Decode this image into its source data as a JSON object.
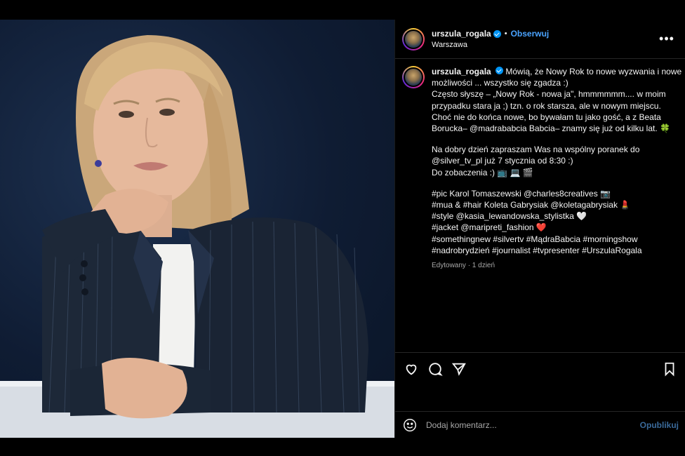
{
  "post": {
    "username": "urszula_rogala",
    "verified": true,
    "follow_label": "Obserwuj",
    "location": "Warszawa",
    "more_icon": "more-horizontal-icon"
  },
  "caption": {
    "lines": [
      "Mówią, że Nowy Rok to nowe wyzwania i nowe",
      "możliwości ... wszystko się zgadza :)",
      "Często słyszę – „Nowy Rok - nowa ja\", hmmmmmm.... w moim",
      "przypadku stara ja ;) tzn. o rok starsza, ale w nowym miejscu.",
      "Choć nie do końca nowe, bo bywałam tu jako gość, a z Beata",
      "Borucka– @madrababcia Babcia– znamy się już od kilku lat. 🍀",
      "",
      "Na dobry dzień zapraszam Was na wspólny poranek do",
      "@silver_tv_pl już 7 stycznia od 8:30 :)",
      "Do zobaczenia :) 📺 💻 🎬",
      "",
      "#pic Karol Tomaszewski @charles8creatives 📷",
      "#mua & #hair Koleta Gabrysiak @koletagabrysiak 💄",
      "#style @kasia_lewandowska_stylistka 🤍",
      "#jacket @maripreti_fashion ❤️",
      "#somethingnew #silvertv #MądraBabcia #morningshow",
      "#nadrobrydzień #journalist #tvpresenter #UrszulaRogala"
    ],
    "edited": "Edytowany · 1 dzień"
  },
  "actions": {
    "like_icon": "heart-icon",
    "comment_icon": "comment-icon",
    "share_icon": "send-icon",
    "save_icon": "bookmark-icon"
  },
  "comment": {
    "placeholder": "Dodaj komentarz...",
    "publish_label": "Opublikuj",
    "emoji_icon": "emoji-icon"
  },
  "colors": {
    "accent": "#0095f6",
    "follow": "#4aa3ff",
    "background": "#000000"
  }
}
